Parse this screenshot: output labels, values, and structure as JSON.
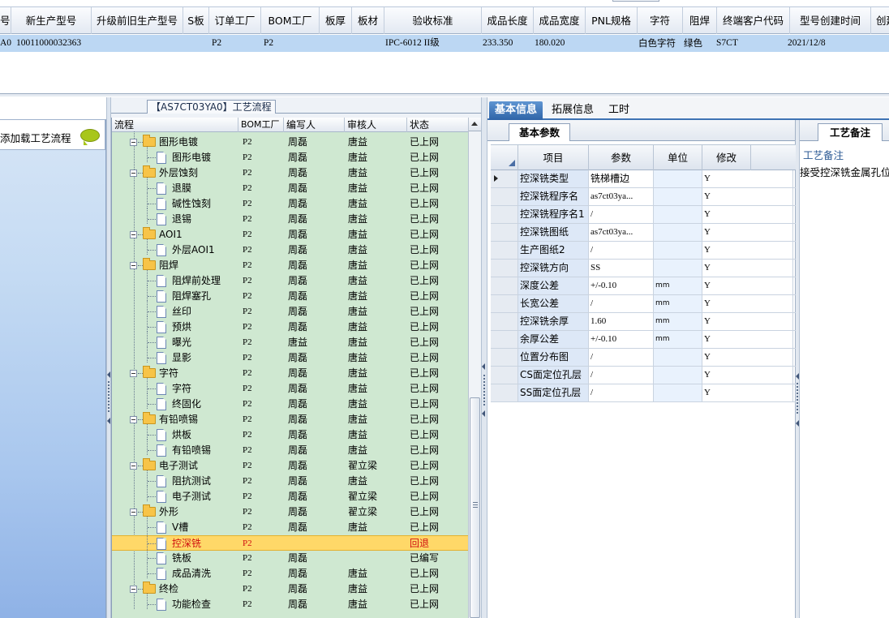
{
  "top_grid": {
    "headers": [
      "号",
      "新生产型号",
      "升级前旧生产型号",
      "S板",
      "订单工厂",
      "BOM工厂",
      "板厚",
      "板材",
      "验收标准",
      "成品长度",
      "成品宽度",
      "PNL规格",
      "字符",
      "阻焊",
      "终端客户代码",
      "型号创建时间",
      "创建"
    ],
    "row": {
      "col0": "A0",
      "new_model": "10011000032363",
      "order_factory": "P2",
      "bom_factory": "P2",
      "acceptance": "IPC-6012 II级",
      "length": "233.350",
      "width": "180.020",
      "char": "白色字符",
      "mask": "绿色",
      "customer": "S7CT",
      "created": "2021/12/8"
    }
  },
  "left_panel": {
    "label": "添加载工艺流程"
  },
  "flow": {
    "title": "【AS7CT03YA0】工艺流程",
    "headers": {
      "name": "流程",
      "bom": "BOM工厂",
      "writer": "编写人",
      "reviewer": "审核人",
      "status": "状态"
    },
    "rows": [
      {
        "level": 0,
        "name": "图形电镀",
        "bom": "P2",
        "writer": "周磊",
        "reviewer": "唐益",
        "status": "已上网"
      },
      {
        "level": 1,
        "name": "图形电镀",
        "bom": "P2",
        "writer": "周磊",
        "reviewer": "唐益",
        "status": "已上网"
      },
      {
        "level": 0,
        "name": "外层蚀刻",
        "bom": "P2",
        "writer": "周磊",
        "reviewer": "唐益",
        "status": "已上网"
      },
      {
        "level": 1,
        "name": "退膜",
        "bom": "P2",
        "writer": "周磊",
        "reviewer": "唐益",
        "status": "已上网"
      },
      {
        "level": 1,
        "name": "碱性蚀刻",
        "bom": "P2",
        "writer": "周磊",
        "reviewer": "唐益",
        "status": "已上网"
      },
      {
        "level": 1,
        "name": "退锡",
        "bom": "P2",
        "writer": "周磊",
        "reviewer": "唐益",
        "status": "已上网"
      },
      {
        "level": 0,
        "name": "AOI1",
        "bom": "P2",
        "writer": "周磊",
        "reviewer": "唐益",
        "status": "已上网"
      },
      {
        "level": 1,
        "name": "外层AOI1",
        "bom": "P2",
        "writer": "周磊",
        "reviewer": "唐益",
        "status": "已上网"
      },
      {
        "level": 0,
        "name": "阻焊",
        "bom": "P2",
        "writer": "周磊",
        "reviewer": "唐益",
        "status": "已上网"
      },
      {
        "level": 1,
        "name": "阻焊前处理",
        "bom": "P2",
        "writer": "周磊",
        "reviewer": "唐益",
        "status": "已上网"
      },
      {
        "level": 1,
        "name": "阻焊塞孔",
        "bom": "P2",
        "writer": "周磊",
        "reviewer": "唐益",
        "status": "已上网"
      },
      {
        "level": 1,
        "name": "丝印",
        "bom": "P2",
        "writer": "周磊",
        "reviewer": "唐益",
        "status": "已上网"
      },
      {
        "level": 1,
        "name": "预烘",
        "bom": "P2",
        "writer": "周磊",
        "reviewer": "唐益",
        "status": "已上网"
      },
      {
        "level": 1,
        "name": "曝光",
        "bom": "P2",
        "writer": "唐益",
        "reviewer": "唐益",
        "status": "已上网"
      },
      {
        "level": 1,
        "name": "显影",
        "bom": "P2",
        "writer": "周磊",
        "reviewer": "唐益",
        "status": "已上网"
      },
      {
        "level": 0,
        "name": "字符",
        "bom": "P2",
        "writer": "周磊",
        "reviewer": "唐益",
        "status": "已上网"
      },
      {
        "level": 1,
        "name": "字符",
        "bom": "P2",
        "writer": "周磊",
        "reviewer": "唐益",
        "status": "已上网"
      },
      {
        "level": 1,
        "name": "终固化",
        "bom": "P2",
        "writer": "周磊",
        "reviewer": "唐益",
        "status": "已上网"
      },
      {
        "level": 0,
        "name": "有铅喷锡",
        "bom": "P2",
        "writer": "周磊",
        "reviewer": "唐益",
        "status": "已上网"
      },
      {
        "level": 1,
        "name": "烘板",
        "bom": "P2",
        "writer": "周磊",
        "reviewer": "唐益",
        "status": "已上网"
      },
      {
        "level": 1,
        "name": "有铅喷锡",
        "bom": "P2",
        "writer": "周磊",
        "reviewer": "唐益",
        "status": "已上网"
      },
      {
        "level": 0,
        "name": "电子测试",
        "bom": "P2",
        "writer": "周磊",
        "reviewer": "翟立梁",
        "status": "已上网"
      },
      {
        "level": 1,
        "name": "阻抗测试",
        "bom": "P2",
        "writer": "周磊",
        "reviewer": "唐益",
        "status": "已上网"
      },
      {
        "level": 1,
        "name": "电子测试",
        "bom": "P2",
        "writer": "周磊",
        "reviewer": "翟立梁",
        "status": "已上网"
      },
      {
        "level": 0,
        "name": "外形",
        "bom": "P2",
        "writer": "周磊",
        "reviewer": "翟立梁",
        "status": "已上网"
      },
      {
        "level": 1,
        "name": "V槽",
        "bom": "P2",
        "writer": "周磊",
        "reviewer": "唐益",
        "status": "已上网"
      },
      {
        "level": 1,
        "name": "控深铣",
        "bom": "P2",
        "writer": "",
        "reviewer": "",
        "status": "回退",
        "selected": true
      },
      {
        "level": 1,
        "name": "铣板",
        "bom": "P2",
        "writer": "周磊",
        "reviewer": "",
        "status": "已编写"
      },
      {
        "level": 1,
        "name": "成品清洗",
        "bom": "P2",
        "writer": "周磊",
        "reviewer": "唐益",
        "status": "已上网"
      },
      {
        "level": 0,
        "name": "终检",
        "bom": "P2",
        "writer": "周磊",
        "reviewer": "唐益",
        "status": "已上网"
      },
      {
        "level": 1,
        "name": "功能检查",
        "bom": "P2",
        "writer": "周磊",
        "reviewer": "唐益",
        "status": "已上网"
      }
    ]
  },
  "tabs": [
    "基本信息",
    "拓展信息",
    "工时"
  ],
  "params": {
    "section": "基本参数",
    "headers": {
      "item": "项目",
      "param": "参数",
      "unit": "单位",
      "modify": "修改"
    },
    "rows": [
      {
        "item": "控深铣类型",
        "value": "铣梯槽边",
        "unit": "",
        "modify": "Y",
        "current": true
      },
      {
        "item": "控深铣程序名",
        "value": "as7ct03ya...",
        "unit": "",
        "modify": "Y"
      },
      {
        "item": "控深铣程序名1",
        "value": "/",
        "unit": "",
        "modify": "Y"
      },
      {
        "item": "控深铣图纸",
        "value": "as7ct03ya...",
        "unit": "",
        "modify": "Y"
      },
      {
        "item": "生产图纸2",
        "value": "/",
        "unit": "",
        "modify": "Y"
      },
      {
        "item": "控深铣方向",
        "value": "SS",
        "unit": "",
        "modify": "Y"
      },
      {
        "item": "深度公差",
        "value": "+/-0.10",
        "unit": "mm",
        "modify": "Y"
      },
      {
        "item": "长宽公差",
        "value": "/",
        "unit": "mm",
        "modify": "Y"
      },
      {
        "item": "控深铣余厚",
        "value": "1.60",
        "unit": "mm",
        "modify": "Y"
      },
      {
        "item": "余厚公差",
        "value": "+/-0.10",
        "unit": "mm",
        "modify": "Y"
      },
      {
        "item": "位置分布图",
        "value": "/",
        "unit": "",
        "modify": "Y"
      },
      {
        "item": "CS面定位孔层",
        "value": "/",
        "unit": "",
        "modify": "Y"
      },
      {
        "item": "SS面定位孔层",
        "value": "/",
        "unit": "",
        "modify": "Y"
      }
    ]
  },
  "notes": {
    "tab": "工艺备注",
    "label": "工艺备注",
    "text": "接受控深铣金属孔位达"
  }
}
